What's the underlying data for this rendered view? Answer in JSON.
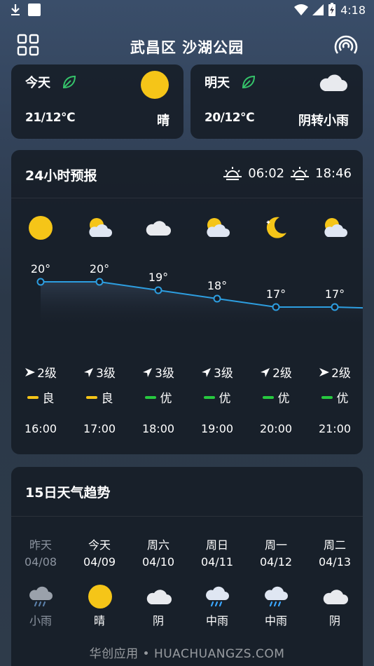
{
  "status_bar": {
    "time": "4:18"
  },
  "header": {
    "location": "武昌区  沙湖公园"
  },
  "today": {
    "name": "今天",
    "temp": "21/12℃",
    "condition": "晴"
  },
  "tomorrow": {
    "name": "明天",
    "temp": "20/12℃",
    "condition": "阴转小雨"
  },
  "hourly": {
    "title": "24小时预报",
    "sunrise": "06:02",
    "sunset": "18:46",
    "items": [
      {
        "time": "16:00",
        "temp": 20,
        "temp_label": "20°",
        "icon": "sun-icon",
        "wind_dir": "arrow-right",
        "wind": "2级",
        "aqi": "良",
        "aqi_color": "#f5c518"
      },
      {
        "time": "17:00",
        "temp": 20,
        "temp_label": "20°",
        "icon": "partly-cloudy-icon",
        "wind_dir": "arrow-upleft",
        "wind": "3级",
        "aqi": "良",
        "aqi_color": "#f5c518"
      },
      {
        "time": "18:00",
        "temp": 19,
        "temp_label": "19°",
        "icon": "cloud-icon",
        "wind_dir": "arrow-upleft",
        "wind": "3级",
        "aqi": "优",
        "aqi_color": "#27c93f"
      },
      {
        "time": "19:00",
        "temp": 18,
        "temp_label": "18°",
        "icon": "partly-cloudy-icon",
        "wind_dir": "arrow-upleft",
        "wind": "3级",
        "aqi": "优",
        "aqi_color": "#27c93f"
      },
      {
        "time": "20:00",
        "temp": 17,
        "temp_label": "17°",
        "icon": "moon-icon",
        "wind_dir": "arrow-upleft",
        "wind": "2级",
        "aqi": "优",
        "aqi_color": "#27c93f"
      },
      {
        "time": "21:00",
        "temp": 17,
        "temp_label": "17°",
        "icon": "partly-cloudy-icon",
        "wind_dir": "arrow-right",
        "wind": "2级",
        "aqi": "优",
        "aqi_color": "#27c93f"
      }
    ]
  },
  "trend": {
    "title": "15日天气趋势",
    "items": [
      {
        "name": "昨天",
        "date": "04/08",
        "condition": "小雨",
        "icon": "rain-cloud-icon",
        "past": true
      },
      {
        "name": "今天",
        "date": "04/09",
        "condition": "晴",
        "icon": "sun-icon",
        "past": false
      },
      {
        "name": "周六",
        "date": "04/10",
        "condition": "阴",
        "icon": "cloud-icon",
        "past": false
      },
      {
        "name": "周日",
        "date": "04/11",
        "condition": "中雨",
        "icon": "rain-cloud-icon",
        "past": false
      },
      {
        "name": "周一",
        "date": "04/12",
        "condition": "中雨",
        "icon": "rain-cloud-icon",
        "past": false
      },
      {
        "name": "周二",
        "date": "04/13",
        "condition": "阴",
        "icon": "cloud-icon",
        "past": false
      }
    ]
  },
  "watermark": "华创应用 • HUACHUANGZS.COM",
  "colors": {
    "card_bg": "#161c26",
    "line": "#2d9ee0",
    "aqi_good": "#27c93f",
    "aqi_fair": "#f5c518",
    "sun": "#f5c518"
  }
}
